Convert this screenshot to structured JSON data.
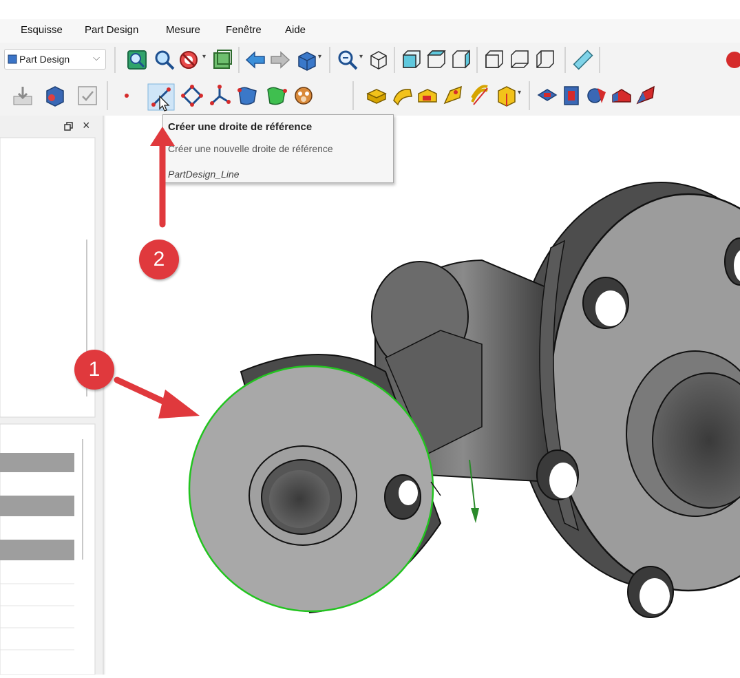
{
  "menubar": {
    "items": [
      "Esquisse",
      "Part Design",
      "Mesure",
      "Fenêtre",
      "Aide"
    ]
  },
  "toolbar": {
    "workbench_label": "Part Design"
  },
  "tooltip": {
    "title": "Créer une droite de référence",
    "description": "Créer une nouvelle droite de référence",
    "command": "PartDesign_Line"
  },
  "annotations": {
    "badge_1": "1",
    "badge_2": "2"
  },
  "colors": {
    "accent_red": "#e0393d",
    "selection_green": "#22c41f"
  }
}
